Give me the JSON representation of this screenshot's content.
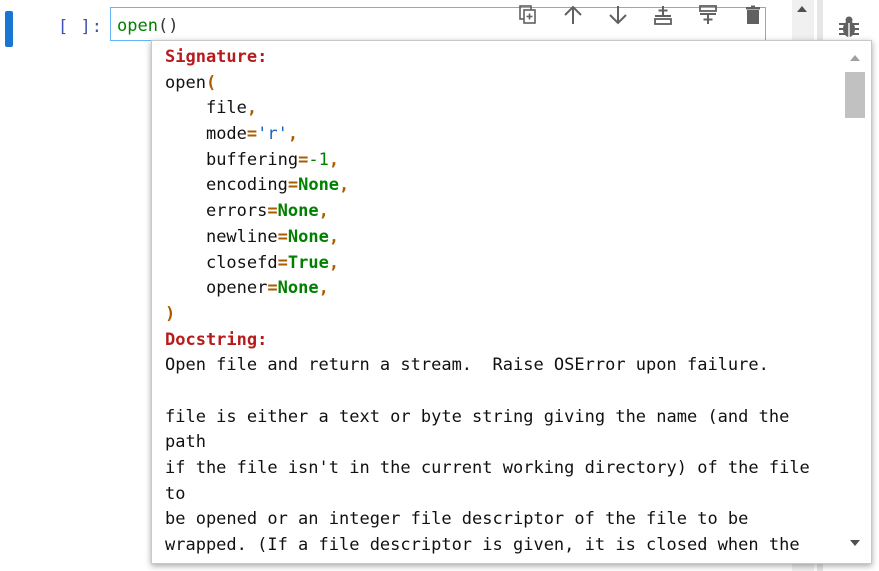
{
  "cell": {
    "prompt": "[ ]:",
    "code_fn": "open",
    "code_parens": "()"
  },
  "toolbar": {
    "items": [
      {
        "name": "copy-cell-icon"
      },
      {
        "name": "move-up-icon"
      },
      {
        "name": "move-down-icon"
      },
      {
        "name": "insert-above-icon"
      },
      {
        "name": "insert-below-icon"
      },
      {
        "name": "delete-icon"
      }
    ]
  },
  "debugger_icon": "bug-icon",
  "tooltip": {
    "signature_heading": "Signature:",
    "sig_open": "open",
    "sig_lparen": "(",
    "params": [
      {
        "name": "file",
        "value": ""
      },
      {
        "name": "mode",
        "value": "'r'"
      },
      {
        "name": "buffering",
        "value": "-1"
      },
      {
        "name": "encoding",
        "value": "None"
      },
      {
        "name": "errors",
        "value": "None"
      },
      {
        "name": "newline",
        "value": "None"
      },
      {
        "name": "closefd",
        "value": "True"
      },
      {
        "name": "opener",
        "value": "None"
      }
    ],
    "sig_rparen": ")",
    "docstring_heading": "Docstring:",
    "doc_lines": [
      "Open file and return a stream.  Raise OSError upon failure.",
      "",
      "file is either a text or byte string giving the name (and the",
      "path",
      "if the file isn't in the current working directory) of the file",
      "to",
      "be opened or an integer file descriptor of the file to be",
      "wrapped. (If a file descriptor is given, it is closed when the"
    ]
  },
  "colors": {
    "cell_active_bar": "#1976d2",
    "heading": "#b71c1c",
    "keyword": "#008000",
    "string": "#1565c0",
    "operator": "#aa5d00"
  }
}
